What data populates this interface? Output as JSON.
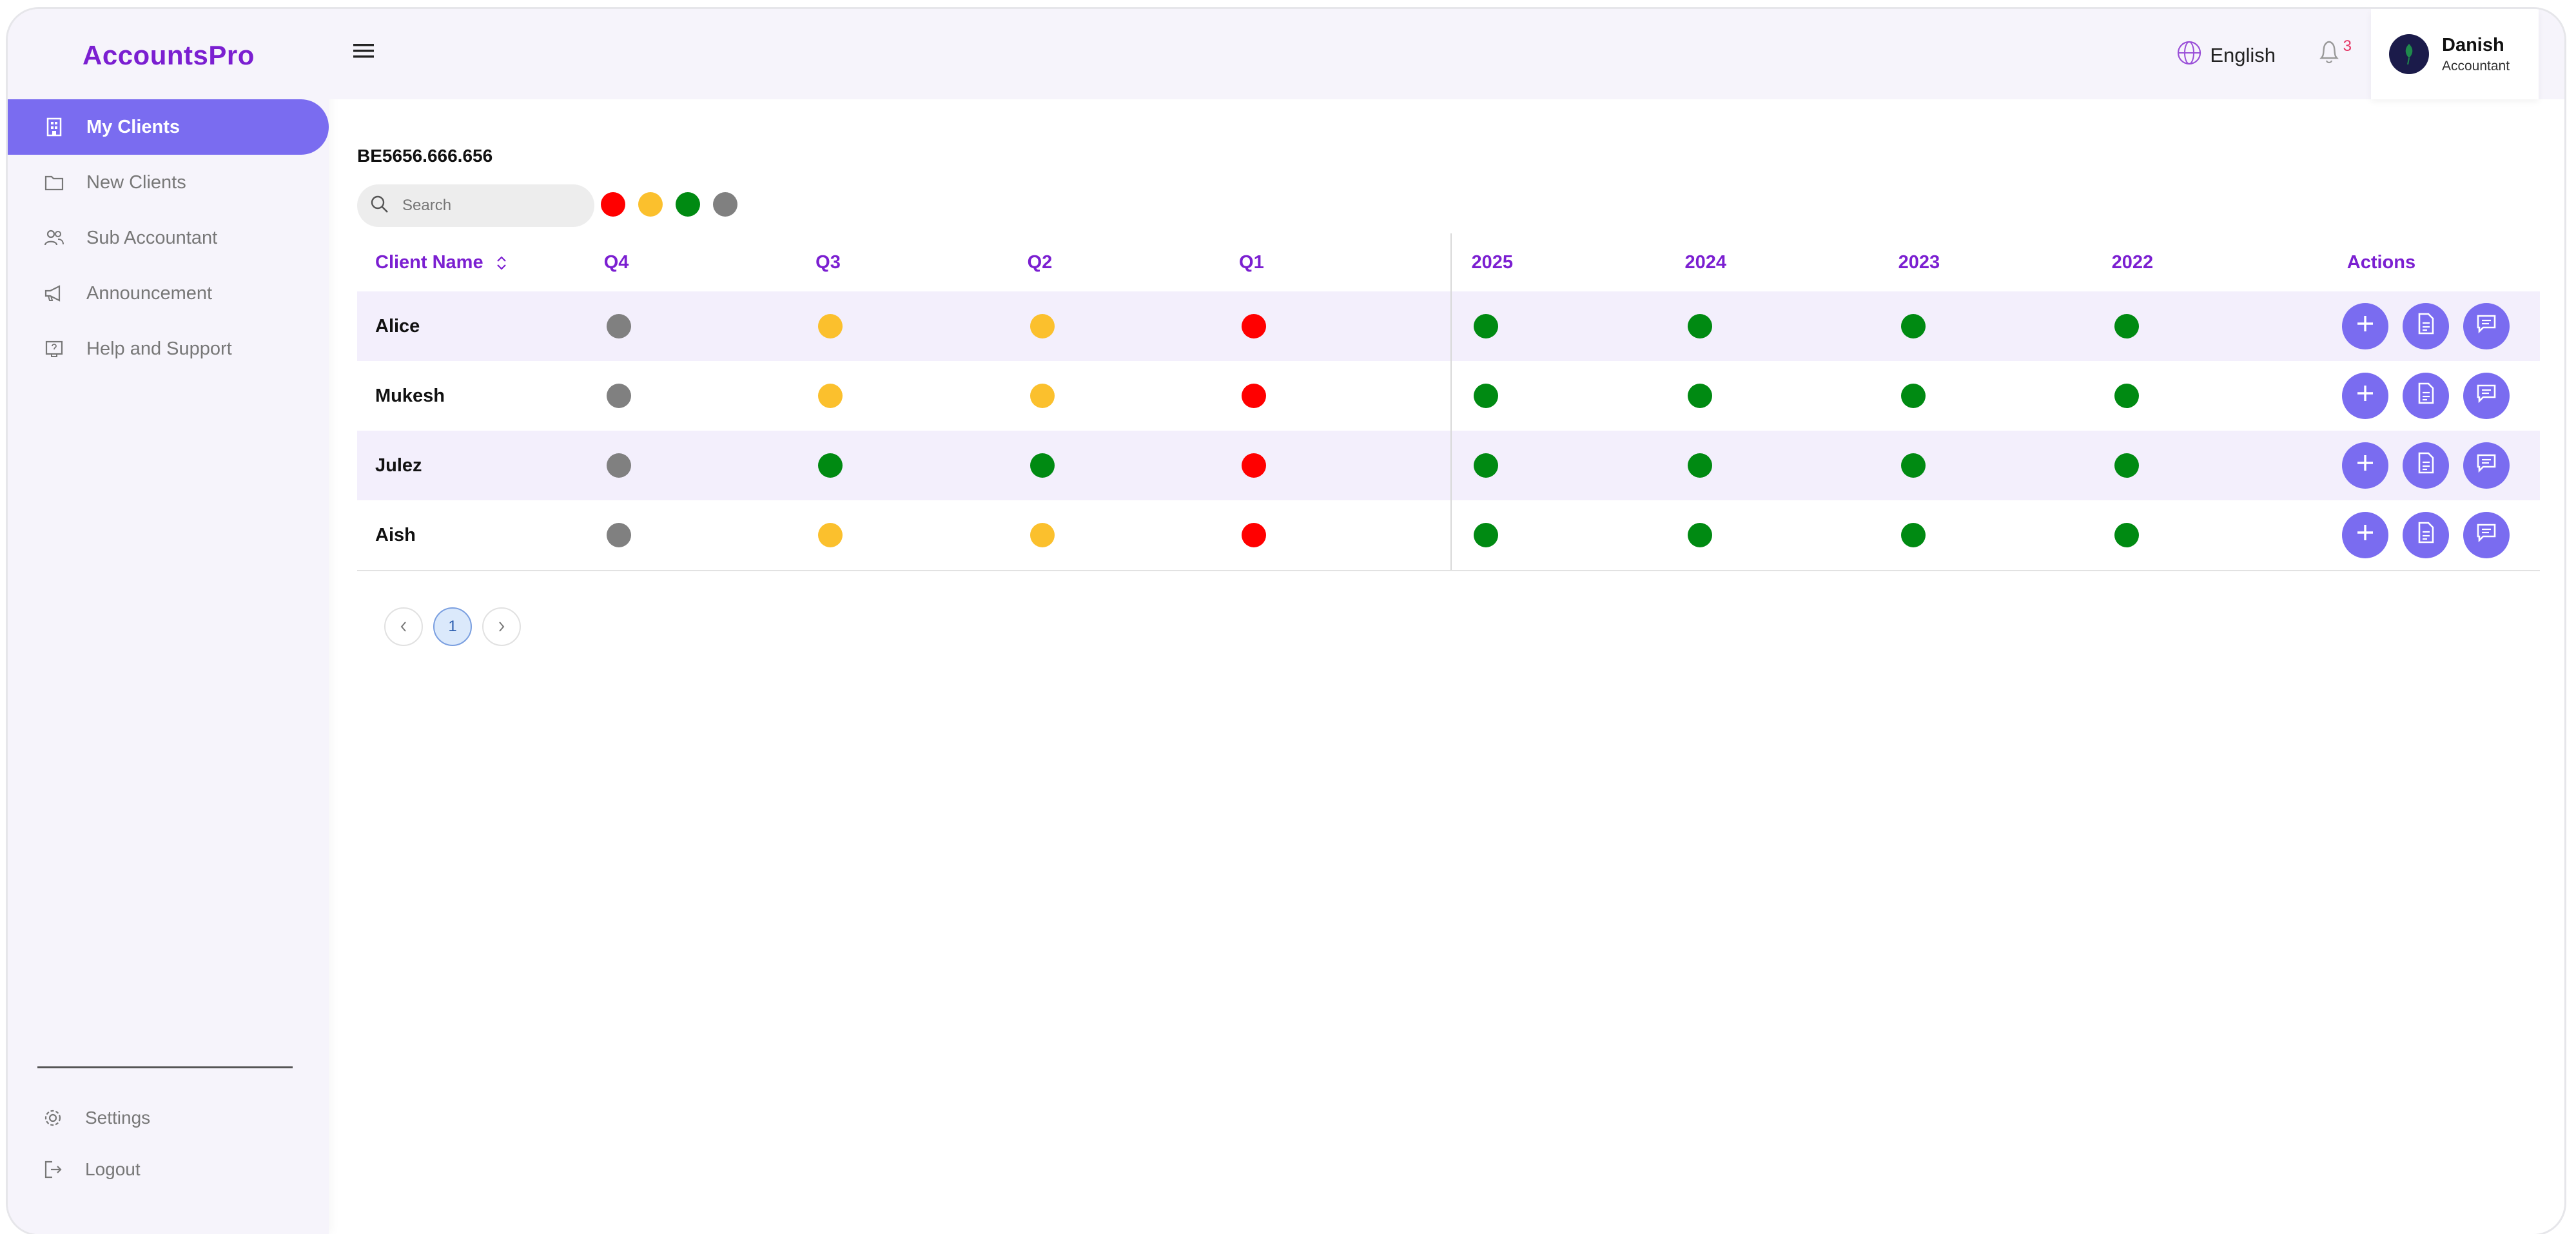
{
  "app": {
    "logo": "AccountsPro"
  },
  "sidebar": {
    "items": [
      {
        "label": "My Clients",
        "icon": "building-icon",
        "active": true
      },
      {
        "label": "New Clients",
        "icon": "folder-icon",
        "active": false
      },
      {
        "label": "Sub Accountant",
        "icon": "users-icon",
        "active": false
      },
      {
        "label": "Announcement",
        "icon": "megaphone-icon",
        "active": false
      },
      {
        "label": "Help and Support",
        "icon": "help-book-icon",
        "active": false
      }
    ],
    "bottom": [
      {
        "label": "Settings",
        "icon": "gear-icon"
      },
      {
        "label": "Logout",
        "icon": "logout-icon"
      }
    ]
  },
  "header": {
    "language": "English",
    "notifications_count": "3",
    "user": {
      "name": "Danish",
      "role": "Accountant"
    }
  },
  "main": {
    "company_id": "BE5656.666.656",
    "search": {
      "placeholder": "Search",
      "value": ""
    },
    "legend_colors": [
      "#ff0000",
      "#fbc02d",
      "#008a12",
      "#808080"
    ],
    "columns": {
      "name": "Client Name",
      "q4": "Q4",
      "q3": "Q3",
      "q2": "Q2",
      "q1": "Q1",
      "y2025": "2025",
      "y2024": "2024",
      "y2023": "2023",
      "y2022": "2022",
      "actions": "Actions"
    },
    "rows": [
      {
        "name": "Alice",
        "status": [
          "#808080",
          "#fbc02d",
          "#fbc02d",
          "#ff0000",
          "#008a12",
          "#008a12",
          "#008a12",
          "#008a12"
        ]
      },
      {
        "name": "Mukesh",
        "status": [
          "#808080",
          "#fbc02d",
          "#fbc02d",
          "#ff0000",
          "#008a12",
          "#008a12",
          "#008a12",
          "#008a12"
        ]
      },
      {
        "name": "Julez",
        "status": [
          "#808080",
          "#008a12",
          "#008a12",
          "#ff0000",
          "#008a12",
          "#008a12",
          "#008a12",
          "#008a12"
        ]
      },
      {
        "name": "Aish",
        "status": [
          "#808080",
          "#fbc02d",
          "#fbc02d",
          "#ff0000",
          "#008a12",
          "#008a12",
          "#008a12",
          "#008a12"
        ]
      }
    ],
    "pagination": {
      "current": "1"
    }
  }
}
